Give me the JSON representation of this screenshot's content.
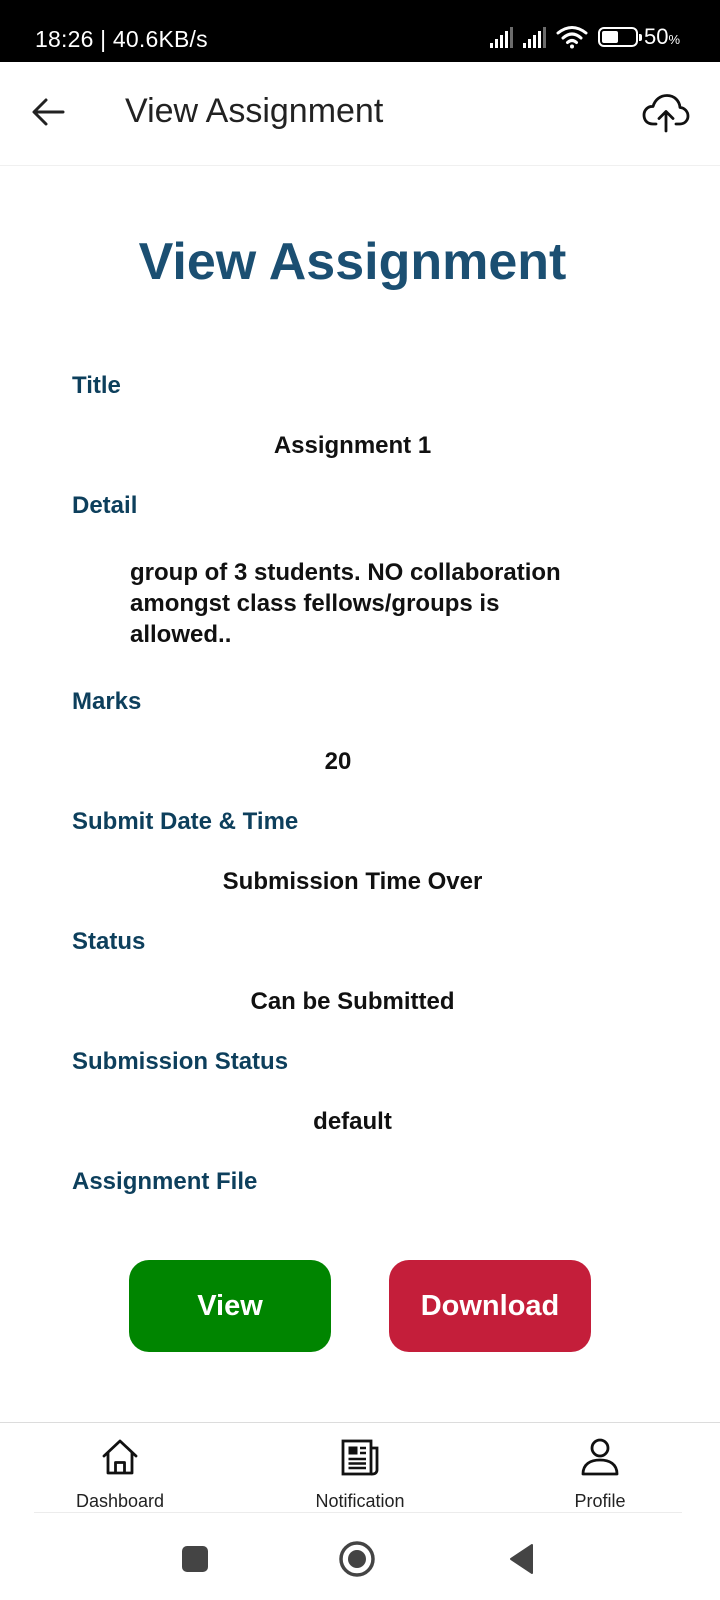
{
  "status_bar": {
    "time_and_speed": "18:26 | 40.6KB/s",
    "battery_percent": "50",
    "battery_unit": "%",
    "battery_level": 0.5
  },
  "app_bar": {
    "title": "View Assignment",
    "back_icon": "arrow-left-icon",
    "action_icon": "cloud-upload-icon"
  },
  "page": {
    "heading": "View Assignment",
    "fields": {
      "title": {
        "label": "Title",
        "value": "Assignment 1"
      },
      "detail": {
        "label": "Detail",
        "value": "group of 3 students. NO collaboration amongst class fellows/groups is allowed.."
      },
      "marks": {
        "label": "Marks",
        "value": "20"
      },
      "submit_date": {
        "label": "Submit Date & Time",
        "value": "Submission Time Over"
      },
      "status": {
        "label": "Status",
        "value": "Can be Submitted"
      },
      "submission_status": {
        "label": "Submission Status",
        "value": "default"
      },
      "assignment_file": {
        "label": "Assignment File"
      }
    },
    "buttons": {
      "view": "View",
      "download": "Download"
    }
  },
  "bottom_nav": {
    "items": [
      {
        "label": "Dashboard",
        "icon": "home-icon"
      },
      {
        "label": "Notification",
        "icon": "newspaper-icon"
      },
      {
        "label": "Profile",
        "icon": "user-icon"
      }
    ]
  },
  "system_nav": {
    "icons": [
      "recent-apps-icon",
      "home-circle-icon",
      "back-triangle-icon"
    ]
  },
  "colors": {
    "heading": "#1b4f72",
    "label": "#0d3f5c",
    "view_button": "#008500",
    "download_button": "#c41e3a"
  }
}
